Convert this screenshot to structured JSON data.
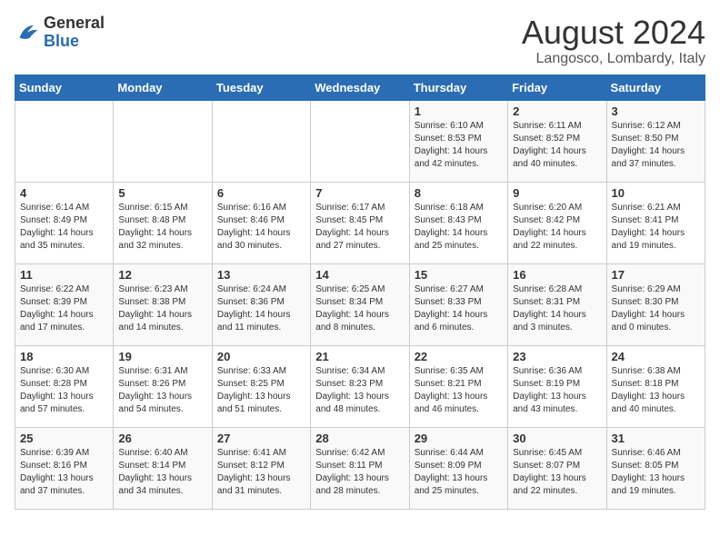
{
  "header": {
    "logo_general": "General",
    "logo_blue": "Blue",
    "month_year": "August 2024",
    "location": "Langosco, Lombardy, Italy"
  },
  "weekdays": [
    "Sunday",
    "Monday",
    "Tuesday",
    "Wednesday",
    "Thursday",
    "Friday",
    "Saturday"
  ],
  "weeks": [
    [
      {
        "day": "",
        "info": ""
      },
      {
        "day": "",
        "info": ""
      },
      {
        "day": "",
        "info": ""
      },
      {
        "day": "",
        "info": ""
      },
      {
        "day": "1",
        "info": "Sunrise: 6:10 AM\nSunset: 8:53 PM\nDaylight: 14 hours\nand 42 minutes."
      },
      {
        "day": "2",
        "info": "Sunrise: 6:11 AM\nSunset: 8:52 PM\nDaylight: 14 hours\nand 40 minutes."
      },
      {
        "day": "3",
        "info": "Sunrise: 6:12 AM\nSunset: 8:50 PM\nDaylight: 14 hours\nand 37 minutes."
      }
    ],
    [
      {
        "day": "4",
        "info": "Sunrise: 6:14 AM\nSunset: 8:49 PM\nDaylight: 14 hours\nand 35 minutes."
      },
      {
        "day": "5",
        "info": "Sunrise: 6:15 AM\nSunset: 8:48 PM\nDaylight: 14 hours\nand 32 minutes."
      },
      {
        "day": "6",
        "info": "Sunrise: 6:16 AM\nSunset: 8:46 PM\nDaylight: 14 hours\nand 30 minutes."
      },
      {
        "day": "7",
        "info": "Sunrise: 6:17 AM\nSunset: 8:45 PM\nDaylight: 14 hours\nand 27 minutes."
      },
      {
        "day": "8",
        "info": "Sunrise: 6:18 AM\nSunset: 8:43 PM\nDaylight: 14 hours\nand 25 minutes."
      },
      {
        "day": "9",
        "info": "Sunrise: 6:20 AM\nSunset: 8:42 PM\nDaylight: 14 hours\nand 22 minutes."
      },
      {
        "day": "10",
        "info": "Sunrise: 6:21 AM\nSunset: 8:41 PM\nDaylight: 14 hours\nand 19 minutes."
      }
    ],
    [
      {
        "day": "11",
        "info": "Sunrise: 6:22 AM\nSunset: 8:39 PM\nDaylight: 14 hours\nand 17 minutes."
      },
      {
        "day": "12",
        "info": "Sunrise: 6:23 AM\nSunset: 8:38 PM\nDaylight: 14 hours\nand 14 minutes."
      },
      {
        "day": "13",
        "info": "Sunrise: 6:24 AM\nSunset: 8:36 PM\nDaylight: 14 hours\nand 11 minutes."
      },
      {
        "day": "14",
        "info": "Sunrise: 6:25 AM\nSunset: 8:34 PM\nDaylight: 14 hours\nand 8 minutes."
      },
      {
        "day": "15",
        "info": "Sunrise: 6:27 AM\nSunset: 8:33 PM\nDaylight: 14 hours\nand 6 minutes."
      },
      {
        "day": "16",
        "info": "Sunrise: 6:28 AM\nSunset: 8:31 PM\nDaylight: 14 hours\nand 3 minutes."
      },
      {
        "day": "17",
        "info": "Sunrise: 6:29 AM\nSunset: 8:30 PM\nDaylight: 14 hours\nand 0 minutes."
      }
    ],
    [
      {
        "day": "18",
        "info": "Sunrise: 6:30 AM\nSunset: 8:28 PM\nDaylight: 13 hours\nand 57 minutes."
      },
      {
        "day": "19",
        "info": "Sunrise: 6:31 AM\nSunset: 8:26 PM\nDaylight: 13 hours\nand 54 minutes."
      },
      {
        "day": "20",
        "info": "Sunrise: 6:33 AM\nSunset: 8:25 PM\nDaylight: 13 hours\nand 51 minutes."
      },
      {
        "day": "21",
        "info": "Sunrise: 6:34 AM\nSunset: 8:23 PM\nDaylight: 13 hours\nand 48 minutes."
      },
      {
        "day": "22",
        "info": "Sunrise: 6:35 AM\nSunset: 8:21 PM\nDaylight: 13 hours\nand 46 minutes."
      },
      {
        "day": "23",
        "info": "Sunrise: 6:36 AM\nSunset: 8:19 PM\nDaylight: 13 hours\nand 43 minutes."
      },
      {
        "day": "24",
        "info": "Sunrise: 6:38 AM\nSunset: 8:18 PM\nDaylight: 13 hours\nand 40 minutes."
      }
    ],
    [
      {
        "day": "25",
        "info": "Sunrise: 6:39 AM\nSunset: 8:16 PM\nDaylight: 13 hours\nand 37 minutes."
      },
      {
        "day": "26",
        "info": "Sunrise: 6:40 AM\nSunset: 8:14 PM\nDaylight: 13 hours\nand 34 minutes."
      },
      {
        "day": "27",
        "info": "Sunrise: 6:41 AM\nSunset: 8:12 PM\nDaylight: 13 hours\nand 31 minutes."
      },
      {
        "day": "28",
        "info": "Sunrise: 6:42 AM\nSunset: 8:11 PM\nDaylight: 13 hours\nand 28 minutes."
      },
      {
        "day": "29",
        "info": "Sunrise: 6:44 AM\nSunset: 8:09 PM\nDaylight: 13 hours\nand 25 minutes."
      },
      {
        "day": "30",
        "info": "Sunrise: 6:45 AM\nSunset: 8:07 PM\nDaylight: 13 hours\nand 22 minutes."
      },
      {
        "day": "31",
        "info": "Sunrise: 6:46 AM\nSunset: 8:05 PM\nDaylight: 13 hours\nand 19 minutes."
      }
    ]
  ]
}
